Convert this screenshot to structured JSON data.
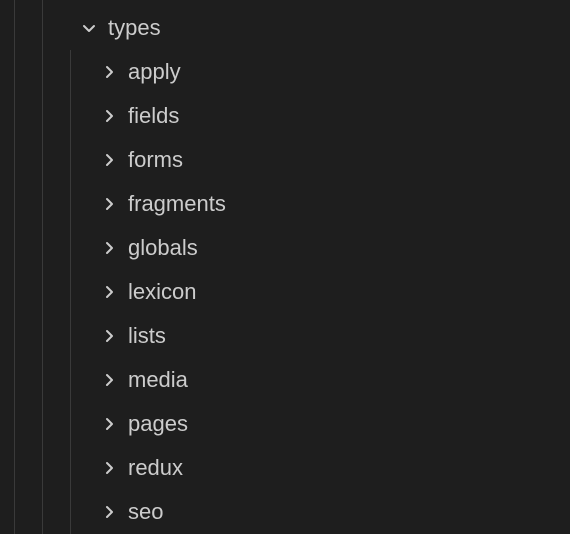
{
  "tree": {
    "parent": {
      "label": "types",
      "expanded": true
    },
    "children": [
      {
        "label": "apply",
        "expanded": false
      },
      {
        "label": "fields",
        "expanded": false
      },
      {
        "label": "forms",
        "expanded": false
      },
      {
        "label": "fragments",
        "expanded": false
      },
      {
        "label": "globals",
        "expanded": false
      },
      {
        "label": "lexicon",
        "expanded": false
      },
      {
        "label": "lists",
        "expanded": false
      },
      {
        "label": "media",
        "expanded": false
      },
      {
        "label": "pages",
        "expanded": false
      },
      {
        "label": "redux",
        "expanded": false
      },
      {
        "label": "seo",
        "expanded": false
      }
    ]
  }
}
